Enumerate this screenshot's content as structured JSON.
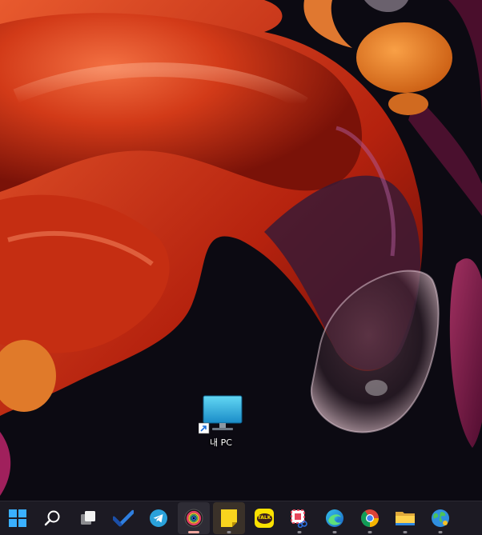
{
  "desktop": {
    "icons": [
      {
        "label": "내 PC",
        "icon": "monitor-icon",
        "shortcut": true
      }
    ]
  },
  "taskbar": {
    "items": [
      {
        "name": "start-button",
        "icon": "windows-logo-icon",
        "running": false
      },
      {
        "name": "search-button",
        "icon": "search-icon",
        "running": false
      },
      {
        "name": "task-view-button",
        "icon": "task-view-icon",
        "running": false
      },
      {
        "name": "todo-app",
        "icon": "checkmark-icon",
        "running": false
      },
      {
        "name": "telegram-app",
        "icon": "telegram-icon",
        "running": false
      },
      {
        "name": "camera-app",
        "icon": "camera-lens-icon",
        "running": true,
        "active": true
      },
      {
        "name": "sticky-notes-app",
        "icon": "sticky-note-icon",
        "running": true
      },
      {
        "name": "kakaotalk-app",
        "icon": "kakaotalk-icon",
        "running": false,
        "badge": "TALK"
      },
      {
        "name": "snipping-app",
        "icon": "snipping-tool-icon",
        "running": true
      },
      {
        "name": "edge-app",
        "icon": "edge-icon",
        "running": true
      },
      {
        "name": "chrome-app",
        "icon": "chrome-icon",
        "running": true
      },
      {
        "name": "file-explorer-app",
        "icon": "folder-icon",
        "running": true
      },
      {
        "name": "globe-app",
        "icon": "globe-icon",
        "running": true
      }
    ]
  },
  "colors": {
    "wallpaper_bg": "#0c0a12",
    "wallpaper_orange": "#d8401a",
    "wallpaper_magenta": "#8a1f5a",
    "taskbar_bg": "#1c1a23",
    "accent": "#f0a8a0"
  }
}
